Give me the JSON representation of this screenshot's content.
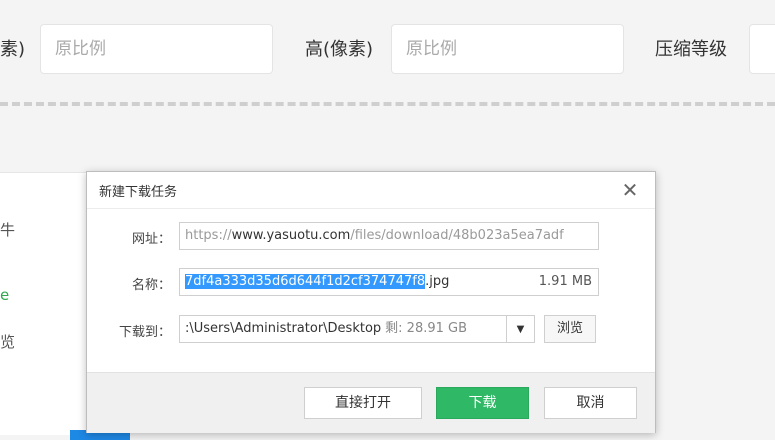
{
  "background": {
    "width_label_partial": "素)",
    "width_input_placeholder": "原比例",
    "height_label": "高(像素)",
    "height_input_placeholder": "原比例",
    "compress_label": "压缩等级",
    "panel_fragments": [
      "牛",
      "e",
      "览"
    ]
  },
  "dialog": {
    "title": "新建下载任务",
    "url_label": "网址：",
    "url_prefix": "https://",
    "url_domain": "www.yasuotu.com",
    "url_path": "/files/download/48b023a5ea7adf",
    "name_label": "名称：",
    "name_selected": "7df4a333d35d6d644f1d2cf374747f8",
    "name_ext": ".jpg",
    "file_size": "1.91 MB",
    "saveto_label": "下载到：",
    "save_path": ":\\Users\\Administrator\\Desktop",
    "free_space": "剩: 28.91 GB",
    "browse_label": "浏览",
    "open_direct_label": "直接打开",
    "download_label": "下载",
    "cancel_label": "取消"
  },
  "colors": {
    "primary_green": "#2fb865",
    "selection_blue": "#3399ff",
    "accent_blue": "#1e88e5"
  }
}
